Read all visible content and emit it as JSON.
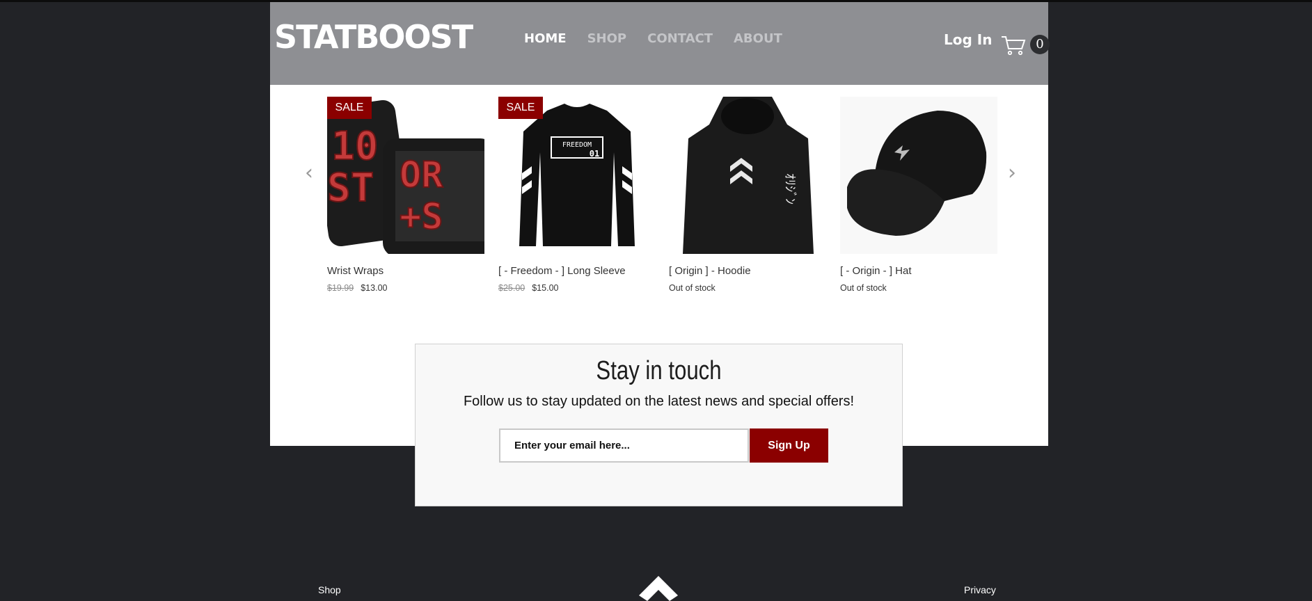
{
  "brand": {
    "logo_text": "STATBOOST"
  },
  "nav": {
    "items": [
      {
        "label": "HOME",
        "active": true
      },
      {
        "label": "SHOP",
        "active": false
      },
      {
        "label": "CONTACT",
        "active": false
      },
      {
        "label": "ABOUT",
        "active": false
      }
    ],
    "login_label": "Log In",
    "cart_count": "0"
  },
  "products": [
    {
      "name": "Wrist Wraps",
      "badge": "SALE",
      "old_price": "$19.99",
      "price": "$13.00",
      "status": "",
      "icon": "wrist-wraps-image"
    },
    {
      "name": "[ - Freedom - ] Long Sleeve",
      "badge": "SALE",
      "old_price": "$25.00",
      "price": "$15.00",
      "status": "",
      "icon": "long-sleeve-image",
      "print_text": "FREEDOM",
      "print_level": "01"
    },
    {
      "name": "[ Origin ] - Hoodie",
      "badge": "",
      "old_price": "",
      "price": "",
      "status": "Out of stock",
      "icon": "hoodie-image"
    },
    {
      "name": "[ - Origin - ] Hat",
      "badge": "",
      "old_price": "",
      "price": "",
      "status": "Out of stock",
      "icon": "hat-image"
    }
  ],
  "carousel": {
    "prev_icon": "chevron-left-icon",
    "next_icon": "chevron-right-icon"
  },
  "subscribe": {
    "title": "Stay in touch",
    "text": "Follow us to stay updated on the latest news and special offers!",
    "email_placeholder": "Enter your email here...",
    "button_label": "Sign Up"
  },
  "footer": {
    "left_link": "Shop",
    "right_link": "Privacy"
  },
  "colors": {
    "header_bg": "#8e8f93",
    "page_bg": "#222327",
    "accent": "#8b0000"
  }
}
